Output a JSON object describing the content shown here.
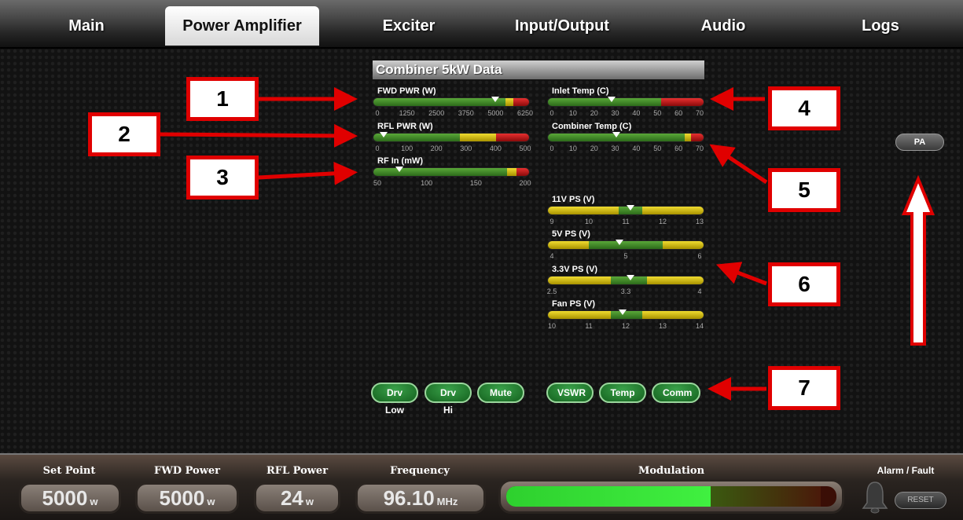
{
  "tabs": [
    {
      "label": "Main",
      "active": false
    },
    {
      "label": "Power Amplifier",
      "active": true
    },
    {
      "label": "Exciter",
      "active": false
    },
    {
      "label": "Input/Output",
      "active": false
    },
    {
      "label": "Audio",
      "active": false
    },
    {
      "label": "Logs",
      "active": false
    }
  ],
  "panel": {
    "title": "Combiner 5kW Data"
  },
  "meters": {
    "fwd_pwr": {
      "label": "FWD PWR (W)",
      "ticks": [
        "0",
        "1250",
        "2500",
        "3750",
        "5000",
        "6250"
      ],
      "marker_fraction": 0.78
    },
    "rfl_pwr": {
      "label": "RFL PWR (W)",
      "ticks": [
        "0",
        "100",
        "200",
        "300",
        "400",
        "500"
      ],
      "marker_fraction": 0.07
    },
    "rf_in": {
      "label": "RF In (mW)",
      "ticks": [
        "50",
        "100",
        "150",
        "200"
      ],
      "marker_fraction": 0.17
    },
    "inlet_temp": {
      "label": "Inlet Temp (C)",
      "ticks": [
        "0",
        "10",
        "20",
        "30",
        "40",
        "50",
        "60",
        "70"
      ],
      "marker_fraction": 0.41
    },
    "combiner_temp": {
      "label": "Combiner Temp (C)",
      "ticks": [
        "0",
        "10",
        "20",
        "30",
        "40",
        "50",
        "60",
        "70"
      ],
      "marker_fraction": 0.44
    },
    "ps_11v": {
      "label": "11V PS (V)",
      "ticks": [
        "9",
        "10",
        "11",
        "12",
        "13"
      ],
      "marker_fraction": 0.53
    },
    "ps_5v": {
      "label": "5V PS (V)",
      "ticks": [
        "4",
        "5",
        "6"
      ],
      "marker_fraction": 0.46
    },
    "ps_3v3": {
      "label": "3.3V PS (V)",
      "ticks": [
        "2.5",
        "3.3",
        "4"
      ],
      "marker_fraction": 0.53
    },
    "fan_ps": {
      "label": "Fan PS (V)",
      "ticks": [
        "10",
        "11",
        "12",
        "13",
        "14"
      ],
      "marker_fraction": 0.48
    }
  },
  "indicators_left": [
    "Drv Low",
    "Drv Hi",
    "Mute"
  ],
  "indicators_right": [
    "VSWR",
    "Temp",
    "Comm"
  ],
  "pa_button": "PA",
  "callouts": [
    "1",
    "2",
    "3",
    "4",
    "5",
    "6",
    "7"
  ],
  "status": {
    "set_point": {
      "label": "Set Point",
      "value": "5000",
      "unit": "w"
    },
    "fwd_power": {
      "label": "FWD Power",
      "value": "5000",
      "unit": "w"
    },
    "rfl_power": {
      "label": "RFL Power",
      "value": "24",
      "unit": "w"
    },
    "frequency": {
      "label": "Frequency",
      "value": "96.10",
      "unit": "MHz"
    },
    "modulation": {
      "label": "Modulation",
      "level_fraction": 0.62
    },
    "alarm": {
      "label": "Alarm / Fault",
      "reset": "RESET"
    }
  },
  "colors": {
    "green": "#3c8a28",
    "yellow": "#d8c000",
    "red": "#c81414",
    "arrow": "#e00000"
  }
}
